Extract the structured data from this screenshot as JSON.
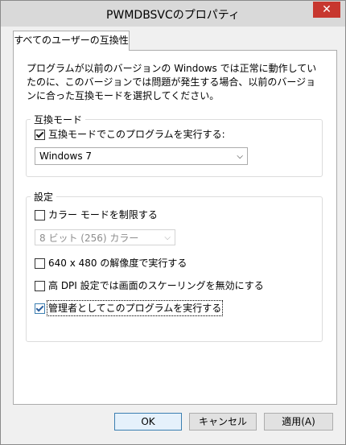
{
  "window": {
    "title": "PWMDBSVCのプロパティ",
    "close_symbol": "✕"
  },
  "tab": {
    "label": "すべてのユーザーの互換性"
  },
  "description": "プログラムが以前のバージョンの Windows では正常に動作していたのに、このバージョンでは問題が発生する場合、以前のバージョンに合った互換モードを選択してください。",
  "compat_mode": {
    "group_label": "互換モード",
    "checkbox_label": "互換モードでこのプログラムを実行する:",
    "checked": true,
    "selected_os": "Windows 7"
  },
  "settings": {
    "group_label": "設定",
    "color_mode_label": "カラー モードを制限する",
    "color_mode_checked": false,
    "color_select_value": "8 ビット (256) カラー",
    "resolution_label": "640 x 480 の解像度で実行する",
    "resolution_checked": false,
    "dpi_label": "高 DPI 設定では画面のスケーリングを無効にする",
    "dpi_checked": false,
    "admin_label": "管理者としてこのプログラムを実行する",
    "admin_checked": true
  },
  "buttons": {
    "ok": "OK",
    "cancel": "キャンセル",
    "apply": "適用(A)"
  },
  "icons": {
    "dropdown": "chevron-down-icon",
    "close": "close-icon"
  }
}
